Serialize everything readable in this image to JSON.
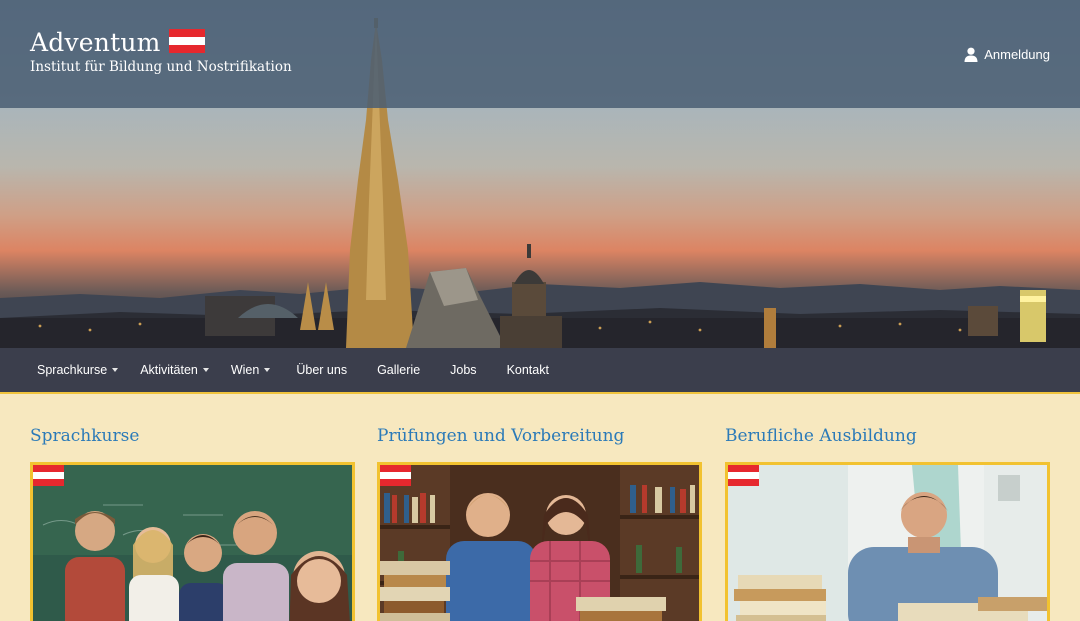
{
  "brand": {
    "title": "Adventum",
    "subtitle": "Institut für Bildung und Nostrifikation",
    "flag_colors": [
      "#e6282e",
      "#ffffff",
      "#e6282e"
    ]
  },
  "header": {
    "login_label": "Anmeldung",
    "login_icon": "user-icon"
  },
  "nav": {
    "items": [
      {
        "label": "Sprachkurse",
        "has_dropdown": true
      },
      {
        "label": "Aktivitäten",
        "has_dropdown": true
      },
      {
        "label": "Wien",
        "has_dropdown": true
      },
      {
        "label": "Über uns",
        "has_dropdown": false
      },
      {
        "label": "Gallerie",
        "has_dropdown": false
      },
      {
        "label": "Jobs",
        "has_dropdown": false
      },
      {
        "label": "Kontakt",
        "has_dropdown": false
      }
    ]
  },
  "sections": [
    {
      "title": "Sprachkurse"
    },
    {
      "title": "Prüfungen und Vorbereitung"
    },
    {
      "title": "Berufliche Ausbildung"
    }
  ],
  "colors": {
    "accent": "#2b7ab8",
    "nav_bg": "#3b3e4c",
    "nav_border": "#f0c33c",
    "page_bg": "#f7e8bf",
    "photo_border": "#f2c230"
  }
}
